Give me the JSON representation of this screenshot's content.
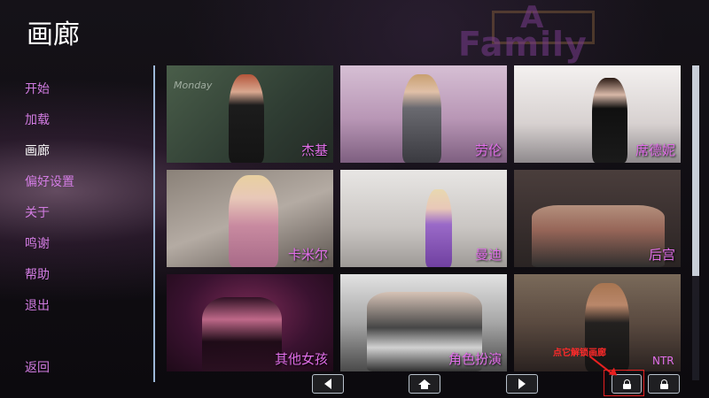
{
  "screen_title": "画廊",
  "background_logo": {
    "line1": "A",
    "line2": "Family"
  },
  "nav": {
    "items": [
      {
        "label": "开始",
        "active": false
      },
      {
        "label": "加载",
        "active": false
      },
      {
        "label": "画廊",
        "active": true
      },
      {
        "label": "偏好设置",
        "active": false
      },
      {
        "label": "关于",
        "active": false
      },
      {
        "label": "鸣谢",
        "active": false
      },
      {
        "label": "帮助",
        "active": false
      },
      {
        "label": "退出",
        "active": false
      }
    ],
    "back_label": "返回"
  },
  "gallery": {
    "tiles": [
      {
        "label": "杰基",
        "chalk_text": "Monday"
      },
      {
        "label": "劳伦"
      },
      {
        "label": "席德妮"
      },
      {
        "label": "卡米尔"
      },
      {
        "label": "曼迪"
      },
      {
        "label": "后宫"
      },
      {
        "label": "其他女孩"
      },
      {
        "label": "角色扮演"
      },
      {
        "label": ""
      }
    ]
  },
  "overlay": {
    "hint_text": "点它解锁画廊",
    "ntr_label": "NTR"
  },
  "colors": {
    "menu_text": "#d27ce2",
    "active_text": "#ffffff",
    "tile_label": "#e06ee8",
    "annotation_red": "#e82020"
  },
  "icons": {
    "prev": "left-triangle",
    "home": "house",
    "next": "right-triangle",
    "unlock": "lock",
    "ntr_lock": "lock"
  }
}
